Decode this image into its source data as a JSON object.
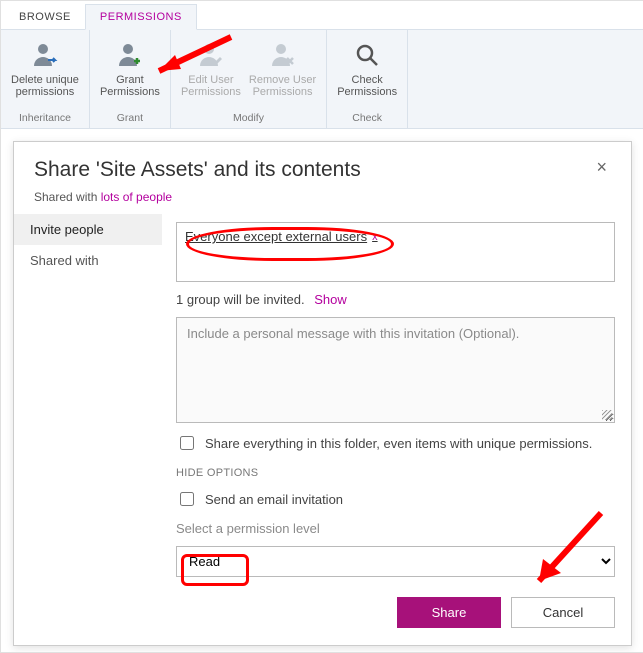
{
  "tabs": {
    "browse": "BROWSE",
    "permissions": "PERMISSIONS"
  },
  "ribbon": {
    "groups": [
      {
        "label": "Inheritance",
        "buttons": [
          {
            "id": "delete-unique",
            "label": "Delete unique\npermissions"
          }
        ]
      },
      {
        "label": "Grant",
        "buttons": [
          {
            "id": "grant",
            "label": "Grant\nPermissions"
          }
        ]
      },
      {
        "label": "Modify",
        "buttons": [
          {
            "id": "edit-user",
            "label": "Edit User\nPermissions",
            "disabled": true
          },
          {
            "id": "remove-user",
            "label": "Remove User\nPermissions",
            "disabled": true
          }
        ]
      },
      {
        "label": "Check",
        "buttons": [
          {
            "id": "check",
            "label": "Check\nPermissions"
          }
        ]
      }
    ]
  },
  "dialog": {
    "title": "Share 'Site Assets' and its contents",
    "shared_prefix": "Shared with ",
    "shared_link": "lots of people",
    "nav": {
      "invite": "Invite people",
      "shared_with": "Shared with"
    },
    "people_chip": "Everyone except external users",
    "chip_remove": "x",
    "status_before": "1 group will be invited.",
    "status_link": "Show",
    "message_placeholder": "Include a personal message with this invitation (Optional).",
    "share_everything": "Share everything in this folder, even items with unique permissions.",
    "hide_options": "HIDE OPTIONS",
    "send_email": "Send an email invitation",
    "select_perm_label": "Select a permission level",
    "perm_value": "Read",
    "share_btn": "Share",
    "cancel_btn": "Cancel",
    "close_glyph": "×"
  }
}
